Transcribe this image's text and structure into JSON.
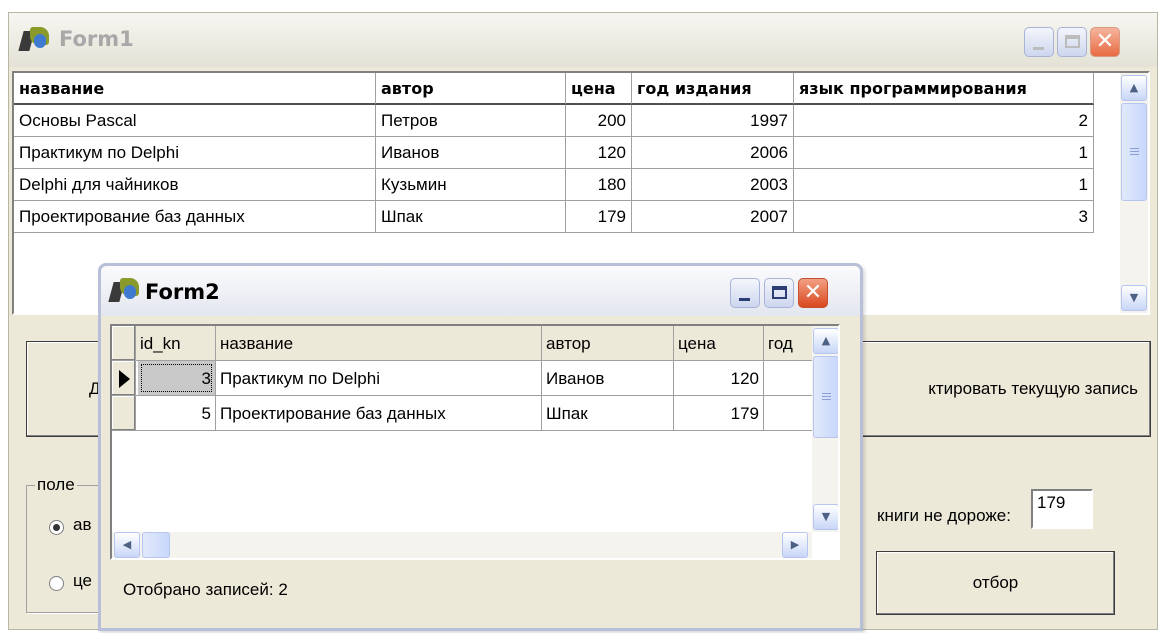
{
  "form1": {
    "title": "Form1",
    "grid": {
      "columns": [
        "название",
        "автор",
        "цена",
        "год издания",
        "язык программирования"
      ],
      "rows": [
        [
          "Основы Pascal",
          "Петров",
          "200",
          "1997",
          "2"
        ],
        [
          "Практикум по Delphi",
          "Иванов",
          "120",
          "2006",
          "1"
        ],
        [
          "Delphi для чайников",
          "Кузьмин",
          "180",
          "2003",
          "1"
        ],
        [
          "Проектирование баз данных",
          "Шпак",
          "179",
          "2007",
          "3"
        ]
      ]
    },
    "add_button_label_visible": "Д",
    "edit_button_label_visible": "ктировать текущую запись",
    "group_title_visible": "поле",
    "radio1_label_visible": "ав",
    "radio2_label_visible": "це",
    "price_label": "книги не дороже:",
    "price_value": "179",
    "filter_button": "отбор"
  },
  "form2": {
    "title": "Form2",
    "grid": {
      "columns": [
        "id_kn",
        "название",
        "автор",
        "цена",
        "год"
      ],
      "rows": [
        [
          "3",
          "Практикум по Delphi",
          "Иванов",
          "120"
        ],
        [
          "5",
          "Проектирование баз данных",
          "Шпак",
          "179"
        ]
      ]
    },
    "status_text": "Отобрано записей: 2"
  },
  "icons": {
    "minimize": "minimize-icon",
    "maximize": "maximize-icon",
    "close": "close-icon",
    "scroll_up": "arrow-up-icon",
    "scroll_down": "arrow-down-icon",
    "scroll_left": "arrow-left-icon",
    "scroll_right": "arrow-right-icon",
    "row_pointer": "row-pointer-icon",
    "app": "delphi-app-icon"
  },
  "colors": {
    "window_face": "#ece9d8",
    "close_button": "#e86a43",
    "scroll_button": "#c8d6f7"
  }
}
